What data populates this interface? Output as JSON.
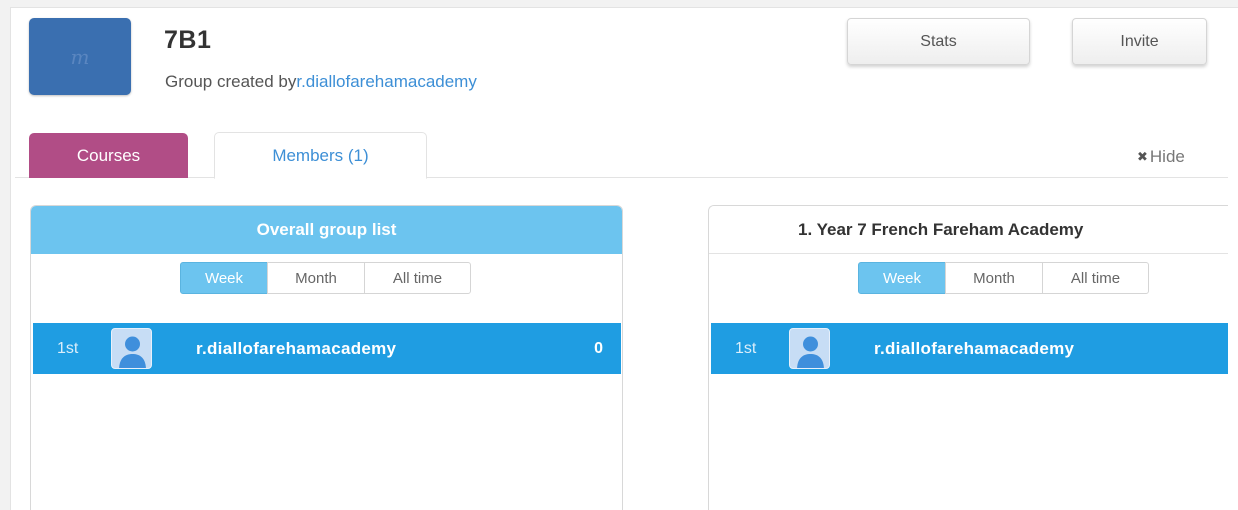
{
  "group": {
    "logo_letter": "m",
    "title": "7B1",
    "created_by_prefix": "Group created by",
    "created_by_user": "r.diallofarehamacademy"
  },
  "actions": {
    "stats_label": "Stats",
    "invite_label": "Invite"
  },
  "tabs": [
    {
      "label": "Courses",
      "active": false
    },
    {
      "label": "Members (1)",
      "active": true
    }
  ],
  "hide_label": "Hide",
  "boards": [
    {
      "title": "Overall group list",
      "periods": [
        "Week",
        "Month",
        "All time"
      ],
      "selected_period": "Week",
      "entries": [
        {
          "rank": "1st",
          "user": "r.diallofarehamacademy",
          "score": "0"
        }
      ]
    },
    {
      "title": "1. Year 7 French Fareham Academy",
      "periods": [
        "Week",
        "Month",
        "All time"
      ],
      "selected_period": "Week",
      "entries": [
        {
          "rank": "1st",
          "user": "r.diallofarehamacademy"
        }
      ]
    }
  ],
  "colors": {
    "logo": "#3a6fb0",
    "courses_tab": "#b14d86",
    "accent_blue": "#6cc4ef",
    "row_highlight": "#1f9de2",
    "link": "#3d8fd6"
  }
}
